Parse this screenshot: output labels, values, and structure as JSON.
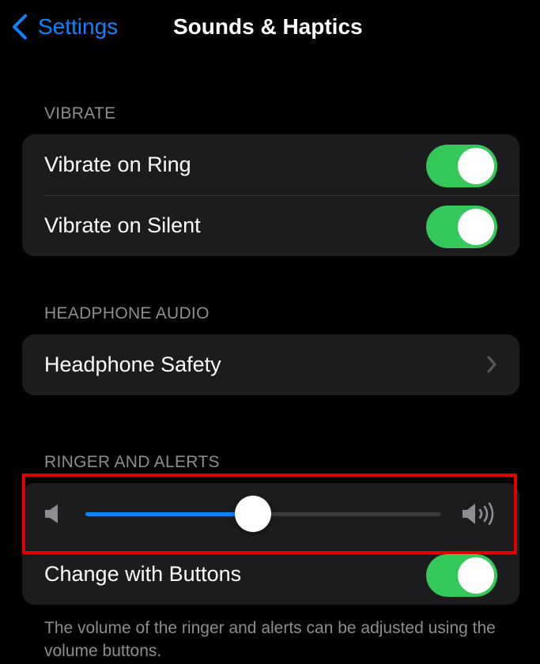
{
  "navbar": {
    "back_label": "Settings",
    "title": "Sounds & Haptics"
  },
  "sections": {
    "vibrate": {
      "header": "VIBRATE",
      "rows": [
        {
          "label": "Vibrate on Ring",
          "toggle_on": true
        },
        {
          "label": "Vibrate on Silent",
          "toggle_on": true
        }
      ]
    },
    "headphone_audio": {
      "header": "HEADPHONE AUDIO",
      "rows": [
        {
          "label": "Headphone Safety"
        }
      ]
    },
    "ringer_and_alerts": {
      "header": "RINGER AND ALERTS",
      "volume_level": 0.47,
      "rows": [
        {
          "label": "Change with Buttons",
          "toggle_on": true
        }
      ],
      "footer": "The volume of the ringer and alerts can be adjusted using the volume buttons."
    }
  },
  "icons": {
    "back": "chevron-left-icon",
    "disclosure": "chevron-right-icon",
    "volume_low": "speaker-low-icon",
    "volume_high": "speaker-high-icon"
  },
  "colors": {
    "accent": "#0a84ff",
    "toggle_on": "#34c759",
    "highlight": "#e00000",
    "group_bg": "#1c1c1e"
  }
}
